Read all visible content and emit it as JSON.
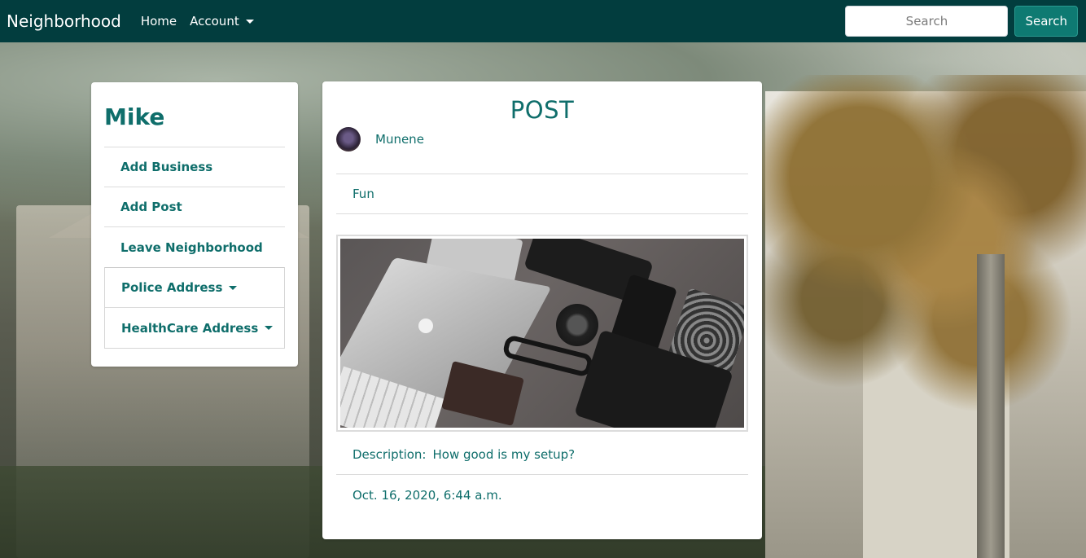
{
  "navbar": {
    "brand": "Neighborhood",
    "links": [
      "Home",
      "Account"
    ],
    "search_placeholder": "Search",
    "search_button": "Search",
    "background_color": "#023d3e"
  },
  "sidebar": {
    "title": "Mike",
    "items": [
      "Add Business",
      "Add Post",
      "Leave Neighborhood"
    ],
    "dropdowns": [
      "Police Address",
      "HealthCare Address"
    ]
  },
  "post": {
    "heading": "POST",
    "author": "Munene",
    "category": "Fun",
    "description_label": "Description:",
    "description": "How good is my setup?",
    "date": "Oct. 16, 2020, 6:44 a.m."
  },
  "colors": {
    "accent": "#0f6e6b",
    "button": "#0e7a72"
  }
}
